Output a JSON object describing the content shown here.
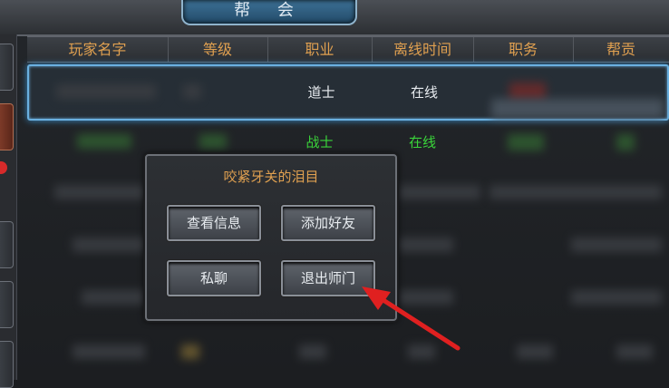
{
  "window": {
    "title": "帮 会"
  },
  "table": {
    "headers": [
      "玩家名字",
      "等级",
      "职业",
      "离线时间",
      "职务",
      "帮贡"
    ],
    "rows": [
      {
        "class": "道士",
        "status": "在线"
      },
      {
        "class": "战士",
        "status": "在线"
      }
    ]
  },
  "popup": {
    "title": "咬紧牙关的泪目",
    "buttons": {
      "view_info": "查看信息",
      "add_friend": "添加好友",
      "private_chat": "私聊",
      "leave_master": "退出师门"
    }
  },
  "colors": {
    "header_text": "#e0a050",
    "online_green": "#3ad43a",
    "selected_border": "#6ab0e0"
  }
}
